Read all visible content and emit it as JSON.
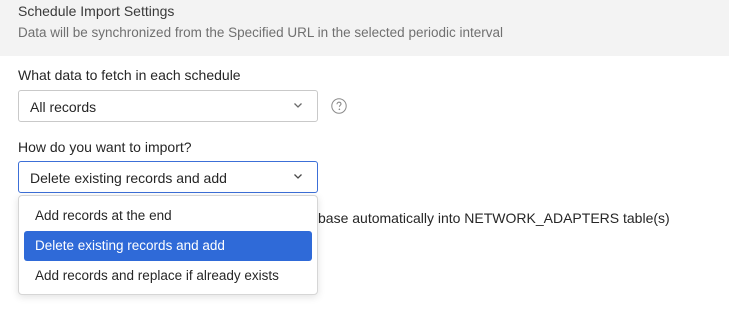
{
  "header": {
    "title": "Schedule Import Settings",
    "subtitle": "Data will be synchronized from the Specified URL in the selected periodic interval"
  },
  "fetch": {
    "label": "What data to fetch in each schedule",
    "selected": "All records",
    "help_icon": "question-circle-icon"
  },
  "import_mode": {
    "label": "How do you want to import?",
    "selected": "Delete existing records and add",
    "options": [
      "Add records at the end",
      "Delete existing records and add",
      "Add records and replace if already exists"
    ],
    "selected_index": 1
  },
  "background_text": "base automatically into NETWORK_ADAPTERS table(s)",
  "colors": {
    "accent": "#2f6ad8",
    "header_bg": "#f3f3f3",
    "focus_border": "#3c6fd7"
  }
}
